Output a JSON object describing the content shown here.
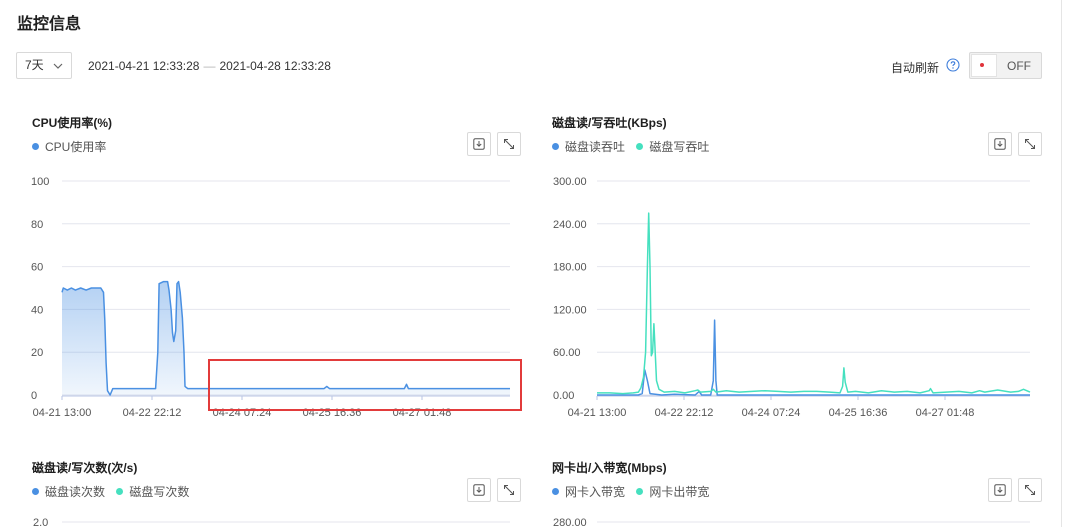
{
  "page": {
    "title": "监控信息"
  },
  "toolbar": {
    "range_select": "7天",
    "time_start": "2021-04-21 12:33:28",
    "time_separator": "—",
    "time_end": "2021-04-28 12:33:28",
    "auto_refresh_label": "自动刷新",
    "help_icon": "question-circle-icon",
    "toggle_state": "OFF",
    "toggle_indicator_color": "#e0333b"
  },
  "colors": {
    "series_blue": "#4a90e2",
    "series_green": "#45e0bf",
    "highlight_red": "#e23b3b"
  },
  "panels": [
    {
      "title": "CPU使用率(%)",
      "legend": [
        "CPU使用率"
      ]
    },
    {
      "title": "磁盘读/写吞吐(KBps)",
      "legend": [
        "磁盘读吞吐",
        "磁盘写吞吐"
      ]
    },
    {
      "title": "磁盘读/写次数(次/s)",
      "legend": [
        "磁盘读次数",
        "磁盘写次数"
      ]
    },
    {
      "title": "网卡出/入带宽(Mbps)",
      "legend": [
        "网卡入带宽",
        "网卡出带宽"
      ]
    }
  ],
  "panel_icons": [
    "download-icon",
    "expand-icon"
  ],
  "chart_data": [
    {
      "type": "area",
      "title": "CPU使用率(%)",
      "xlabel": "",
      "ylabel": "",
      "ylim": [
        0,
        100
      ],
      "yticks": [
        "100",
        "80",
        "60",
        "40",
        "20",
        "0"
      ],
      "xticks": [
        "04-21 13:00",
        "04-22 22:12",
        "04-24 07:24",
        "04-25 16:36",
        "04-27 01:48"
      ],
      "xrange_hours": [
        0,
        167.5
      ],
      "grid": true,
      "legend_position": "top-left",
      "series": [
        {
          "name": "CPU使用率",
          "points": [
            [
              0,
              48
            ],
            [
              0.5,
              50
            ],
            [
              2,
              49
            ],
            [
              3.5,
              50
            ],
            [
              5,
              49
            ],
            [
              7,
              50
            ],
            [
              9,
              49
            ],
            [
              11,
              50
            ],
            [
              13,
              50
            ],
            [
              14.5,
              50
            ],
            [
              15.5,
              48
            ],
            [
              16,
              35
            ],
            [
              16.5,
              15
            ],
            [
              17,
              2
            ],
            [
              18,
              0
            ],
            [
              19,
              3
            ],
            [
              22,
              3
            ],
            [
              26,
              3
            ],
            [
              30,
              3
            ],
            [
              34,
              3
            ],
            [
              35,
              3
            ],
            [
              35.8,
              20
            ],
            [
              36.3,
              52
            ],
            [
              38,
              53
            ],
            [
              39.5,
              53
            ],
            [
              40,
              49
            ],
            [
              40.8,
              40
            ],
            [
              41.3,
              29
            ],
            [
              41.8,
              25
            ],
            [
              42.5,
              30
            ],
            [
              43,
              52
            ],
            [
              43.6,
              53
            ],
            [
              44.2,
              48
            ],
            [
              45,
              36
            ],
            [
              45.6,
              20
            ],
            [
              46,
              4
            ],
            [
              47,
              3
            ],
            [
              52,
              3
            ],
            [
              60,
              3
            ],
            [
              70,
              3
            ],
            [
              80,
              3
            ],
            [
              90,
              3
            ],
            [
              98,
              3
            ],
            [
              99,
              4
            ],
            [
              100,
              3
            ],
            [
              110,
              3
            ],
            [
              120,
              3
            ],
            [
              128,
              3
            ],
            [
              128.8,
              5
            ],
            [
              129.5,
              3
            ],
            [
              140,
              3
            ],
            [
              150,
              3
            ],
            [
              160,
              3
            ],
            [
              167.5,
              3
            ]
          ]
        }
      ]
    },
    {
      "type": "line",
      "title": "磁盘读/写吞吐(KBps)",
      "xlabel": "",
      "ylabel": "",
      "ylim": [
        0,
        300
      ],
      "yticks": [
        "300.00",
        "240.00",
        "180.00",
        "120.00",
        "60.00",
        "0.00"
      ],
      "xticks": [
        "04-21 13:00",
        "04-22 22:12",
        "04-24 07:24",
        "04-25 16:36",
        "04-27 01:48"
      ],
      "xrange_hours": [
        0,
        167.5
      ],
      "grid": true,
      "legend_position": "top-left",
      "series": [
        {
          "name": "磁盘读吞吐",
          "points": [
            [
              0,
              0
            ],
            [
              8,
              0
            ],
            [
              16,
              0
            ],
            [
              17.5,
              2
            ],
            [
              18.5,
              35
            ],
            [
              19.5,
              20
            ],
            [
              20.5,
              2
            ],
            [
              25,
              0
            ],
            [
              30,
              1
            ],
            [
              38,
              0
            ],
            [
              39.5,
              5
            ],
            [
              40.5,
              0
            ],
            [
              44,
              0
            ],
            [
              45,
              20
            ],
            [
              45.5,
              105
            ],
            [
              46,
              20
            ],
            [
              46.5,
              0
            ],
            [
              60,
              0
            ],
            [
              80,
              0
            ],
            [
              100,
              0
            ],
            [
              120,
              0
            ],
            [
              140,
              0
            ],
            [
              167.5,
              0
            ]
          ]
        },
        {
          "name": "磁盘写吞吐",
          "points": [
            [
              0,
              3
            ],
            [
              5,
              3
            ],
            [
              10,
              2
            ],
            [
              14,
              3
            ],
            [
              16,
              4
            ],
            [
              17,
              10
            ],
            [
              18,
              25
            ],
            [
              18.8,
              60
            ],
            [
              19.5,
              180
            ],
            [
              20,
              255
            ],
            [
              20.5,
              180
            ],
            [
              21,
              55
            ],
            [
              21.5,
              60
            ],
            [
              22,
              100
            ],
            [
              22.5,
              60
            ],
            [
              23,
              20
            ],
            [
              24,
              8
            ],
            [
              26,
              4
            ],
            [
              30,
              5
            ],
            [
              34,
              3
            ],
            [
              38,
              6
            ],
            [
              39,
              7
            ],
            [
              40,
              4
            ],
            [
              44,
              5
            ],
            [
              45,
              8
            ],
            [
              46,
              4
            ],
            [
              50,
              6
            ],
            [
              55,
              4
            ],
            [
              60,
              5
            ],
            [
              65,
              6
            ],
            [
              70,
              5
            ],
            [
              75,
              4
            ],
            [
              80,
              5
            ],
            [
              85,
              5
            ],
            [
              90,
              4
            ],
            [
              94,
              3
            ],
            [
              95,
              12
            ],
            [
              95.5,
              38
            ],
            [
              96,
              18
            ],
            [
              97,
              4
            ],
            [
              100,
              5
            ],
            [
              105,
              3
            ],
            [
              110,
              6
            ],
            [
              115,
              4
            ],
            [
              120,
              5
            ],
            [
              125,
              3
            ],
            [
              128.5,
              6
            ],
            [
              129,
              9
            ],
            [
              130,
              3
            ],
            [
              135,
              4
            ],
            [
              140,
              5
            ],
            [
              145,
              3
            ],
            [
              148,
              6
            ],
            [
              150,
              4
            ],
            [
              155,
              7
            ],
            [
              160,
              4
            ],
            [
              163,
              5
            ],
            [
              165,
              8
            ],
            [
              167.5,
              4
            ]
          ]
        }
      ]
    },
    {
      "type": "line",
      "title": "磁盘读/写次数(次/s)",
      "yticks": [
        "2.0"
      ],
      "grid": true,
      "legend_position": "top-left",
      "series": [
        {
          "name": "磁盘读次数"
        },
        {
          "name": "磁盘写次数"
        }
      ]
    },
    {
      "type": "line",
      "title": "网卡出/入带宽(Mbps)",
      "yticks": [
        "280.00"
      ],
      "grid": true,
      "legend_position": "top-left",
      "series": [
        {
          "name": "网卡入带宽"
        },
        {
          "name": "网卡出带宽"
        }
      ]
    }
  ]
}
